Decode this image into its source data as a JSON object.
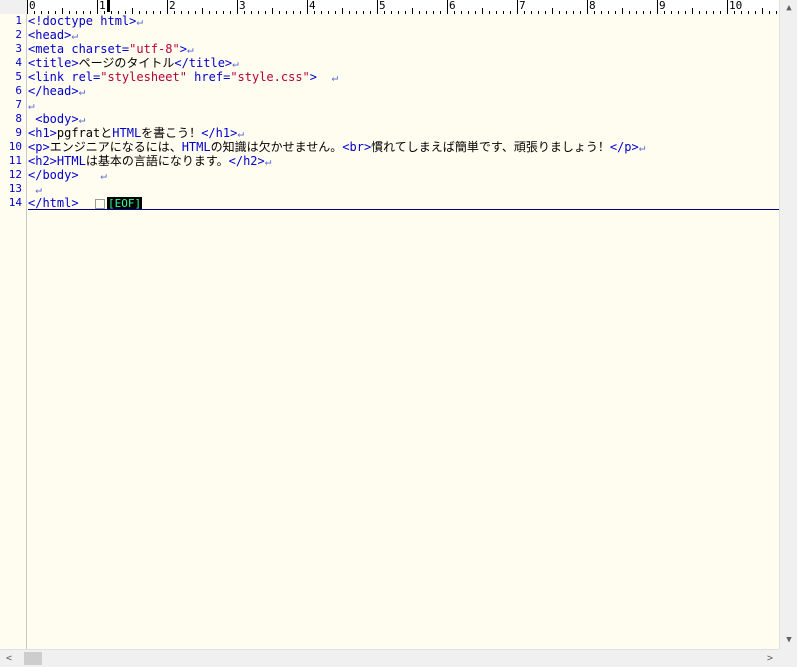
{
  "ruler": {
    "labels": [
      "0",
      "1",
      "2",
      "3",
      "4",
      "5",
      "6",
      "7",
      "8",
      "9",
      "10"
    ]
  },
  "editor": {
    "line_numbers": [
      "1",
      "2",
      "3",
      "4",
      "5",
      "6",
      "7",
      "8",
      "9",
      "10",
      "11",
      "12",
      "13",
      "14"
    ],
    "newline_mark": "↵",
    "eof_label": "[EOF]",
    "lines": {
      "l1": "<!doctype html>",
      "l2": "<head>",
      "l3a": "<meta charset=",
      "l3b": "\"utf-8\"",
      "l3c": ">",
      "l4a": "<title>",
      "l4b": "ページのタイトル",
      "l4c": "</title>",
      "l5a": "<link rel=",
      "l5b": "\"stylesheet\"",
      "l5c": " href=",
      "l5d": "\"style.css\"",
      "l5e": ">",
      "l6": "</head>",
      "l8": " <body>",
      "l9a": "<h1>",
      "l9b": "pgfratと",
      "l9c": "HTML",
      "l9d": "を書こう！",
      "l9e": "</h1>",
      "l10a": "<p>",
      "l10b": "エンジニアになるには、",
      "l10c": "HTML",
      "l10d": "の知識は欠かせません。",
      "l10e": "<br>",
      "l10f": "慣れてしまえば簡単です、頑張りましょう！",
      "l10g": "</p>",
      "l11a": "<h2>",
      "l11b": "HTML",
      "l11c": "は基本の言語になります。",
      "l11d": "</h2>",
      "l12": "</body>",
      "l14": "</html>"
    }
  },
  "scrollbars": {
    "up": "▲",
    "down": "▼",
    "left": "<",
    "right": ">"
  }
}
